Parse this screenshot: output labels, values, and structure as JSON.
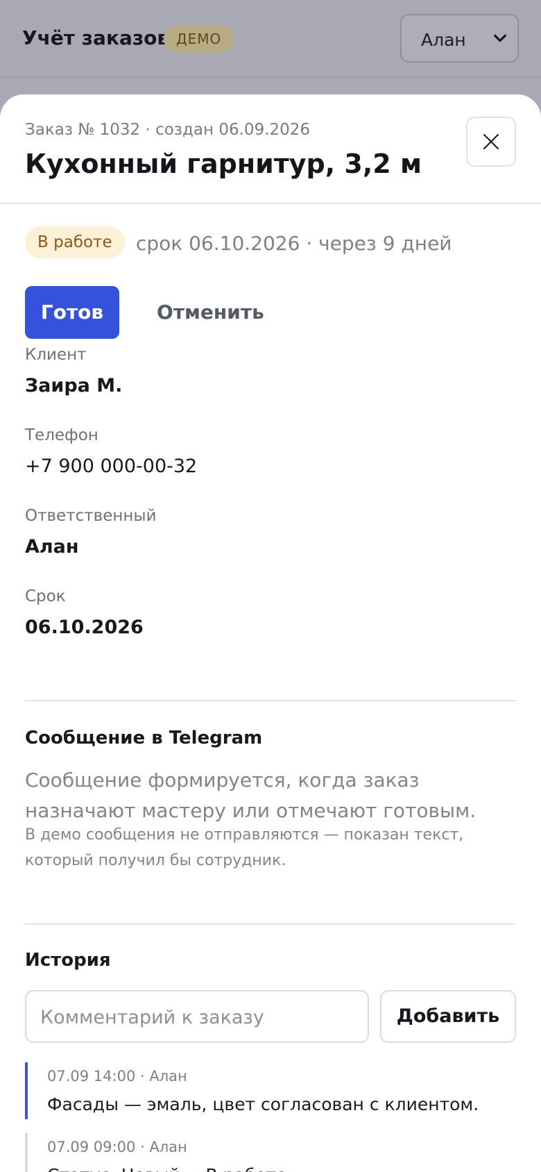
{
  "app": {
    "title": "Учёт заказов",
    "demo_badge": "ДЕМО",
    "user_select": {
      "value": "Алан",
      "icon": "chevron-down-icon"
    }
  },
  "order": {
    "meta": "Заказ № 1032 · создан 06.09.2026",
    "title": "Кухонный гарнитур, 3,2 м",
    "close_icon": "close-icon",
    "status": {
      "label": "В работе",
      "bg": "#fdf0d8",
      "color": "#8a5a14"
    },
    "deadline_text": "срок 06.10.2026 · через 9 дней",
    "actions": {
      "primary": "Готов",
      "secondary": "Отменить",
      "primary_color": "#3452db"
    },
    "fields": [
      {
        "label": "Клиент",
        "value": "Заира М."
      },
      {
        "label": "Телефон",
        "value": "+7 900 000-00-32"
      },
      {
        "label": "Ответственный",
        "value": "Алан"
      },
      {
        "label": "Срок",
        "value": "06.10.2026"
      }
    ]
  },
  "telegram": {
    "title": "Сообщение в Telegram",
    "description": "Сообщение формируется, когда заказ назначают мастеру или отмечают готовым.",
    "note": "В демо сообщения не отправляются — показан текст, который получил бы сотрудник."
  },
  "history": {
    "title": "История",
    "comment_placeholder": "Комментарий к заказу",
    "add_button": "Добавить",
    "items": [
      {
        "meta": "07.09 14:00 · Алан",
        "text": "Фасады — эмаль, цвет согласован с клиентом.",
        "accent": "#3e56c4"
      },
      {
        "meta": "07.09 09:00 · Алан",
        "text": "Статус: Новый → В работе",
        "accent": "#d7d9de"
      }
    ]
  }
}
